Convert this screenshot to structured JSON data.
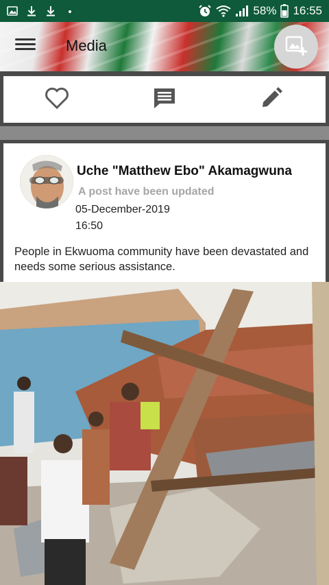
{
  "status_bar": {
    "icons_left": [
      "image-icon",
      "download-icon",
      "download-icon",
      "dot-icon"
    ],
    "icons_right": [
      "alarm-icon",
      "wifi-icon",
      "signal-icon"
    ],
    "battery": "58%",
    "time": "16:55"
  },
  "app_bar": {
    "title": "Media",
    "menu_icon": "hamburger-menu-icon",
    "add_photo_icon": "add-photo-icon"
  },
  "actions": {
    "like_icon": "heart-outline-icon",
    "comment_icon": "comment-icon",
    "edit_icon": "pencil-icon"
  },
  "post": {
    "author": "Uche \"Matthew Ebo\" Akamagwuna",
    "status": "A post have been updated",
    "date": "05-December-2019",
    "time": "16:50",
    "text": "People in Ekwuoma community have been devastated and needs some serious assistance."
  },
  "colors": {
    "status_bar": "#0e5a3a",
    "card_bg": "#ffffff",
    "icon_gray": "#555555",
    "status_text": "#a6a6a6",
    "band_gray": "#8a8a8a"
  }
}
